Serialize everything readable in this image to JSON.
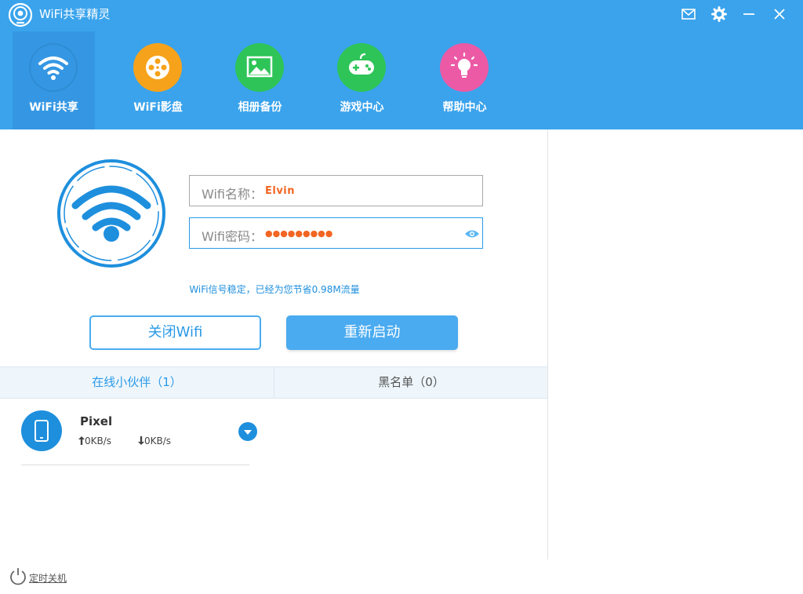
{
  "window": {
    "title": "WiFi共享精灵"
  },
  "nav": {
    "items": [
      {
        "label": "WiFi共享",
        "icon": "wifi-icon",
        "color": "#3597e3"
      },
      {
        "label": "WiFi影盘",
        "icon": "film-reel-icon",
        "color": "#f7a21b"
      },
      {
        "label": "相册备份",
        "icon": "photo-icon",
        "color": "#2ec458"
      },
      {
        "label": "游戏中心",
        "icon": "gamepad-icon",
        "color": "#2ec458"
      },
      {
        "label": "帮助中心",
        "icon": "lightbulb-icon",
        "color": "#ec5aa5"
      }
    ],
    "active_index": 0
  },
  "form": {
    "name_label": "Wifi名称：",
    "name_value": "Elvin",
    "password_label": "Wifi密码：",
    "password_value": "●●●●●●●●●"
  },
  "status": {
    "message": "WiFi信号稳定，已经为您节省0.98M流量"
  },
  "buttons": {
    "turn_off": "关闭Wifi",
    "restart": "重新启动"
  },
  "tabs": {
    "online": "在线小伙伴（1）",
    "blacklist": "黑名单（0）"
  },
  "lists": {
    "devices": [
      {
        "name": "Pixel",
        "upload": "0KB/s",
        "download": "0KB/s",
        "icon": "phone-icon"
      }
    ]
  },
  "footer": {
    "timer_shutdown": "定时关机"
  },
  "colors": {
    "header_bg": "#3aa3ec",
    "accent": "#2b9ae8",
    "password_text": "#f26522"
  }
}
